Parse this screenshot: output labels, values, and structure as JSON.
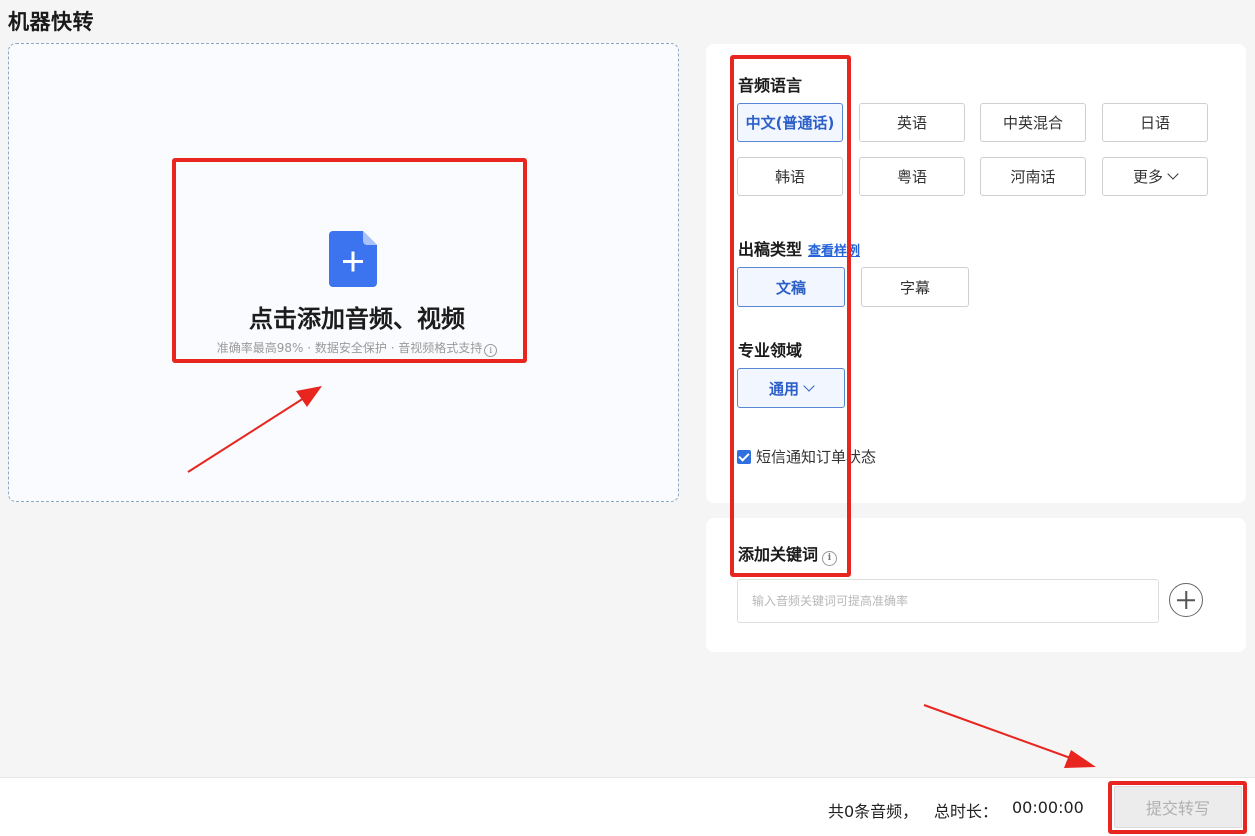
{
  "page": {
    "title": "机器快转"
  },
  "upload": {
    "title": "点击添加音频、视频",
    "subtitle": "准确率最高98% · 数据安全保护 · 音视频格式支持",
    "icon": "file-add-icon",
    "accent_color": "#3b74ee"
  },
  "settings": {
    "language": {
      "label": "音频语言",
      "options": [
        "中文(普通话)",
        "英语",
        "中英混合",
        "日语",
        "韩语",
        "粤语",
        "河南话",
        "更多"
      ],
      "selected": "中文(普通话)"
    },
    "output_type": {
      "label": "出稿类型",
      "example_link": "查看样例",
      "options": [
        "文稿",
        "字幕"
      ],
      "selected": "文稿"
    },
    "domain": {
      "label": "专业领域",
      "selected": "通用"
    },
    "sms": {
      "label": "短信通知订单状态",
      "checked": true
    }
  },
  "keywords": {
    "label": "添加关键词",
    "placeholder": "输入音频关键词可提高准确率"
  },
  "footer": {
    "count_text": "共0条音频，",
    "duration_label": "总时长：",
    "duration_value": "00:00:00",
    "submit_label": "提交转写"
  },
  "colors": {
    "annotation_red": "#e8251f",
    "selected_border": "#5a86d6",
    "link_blue": "#2563d9"
  }
}
